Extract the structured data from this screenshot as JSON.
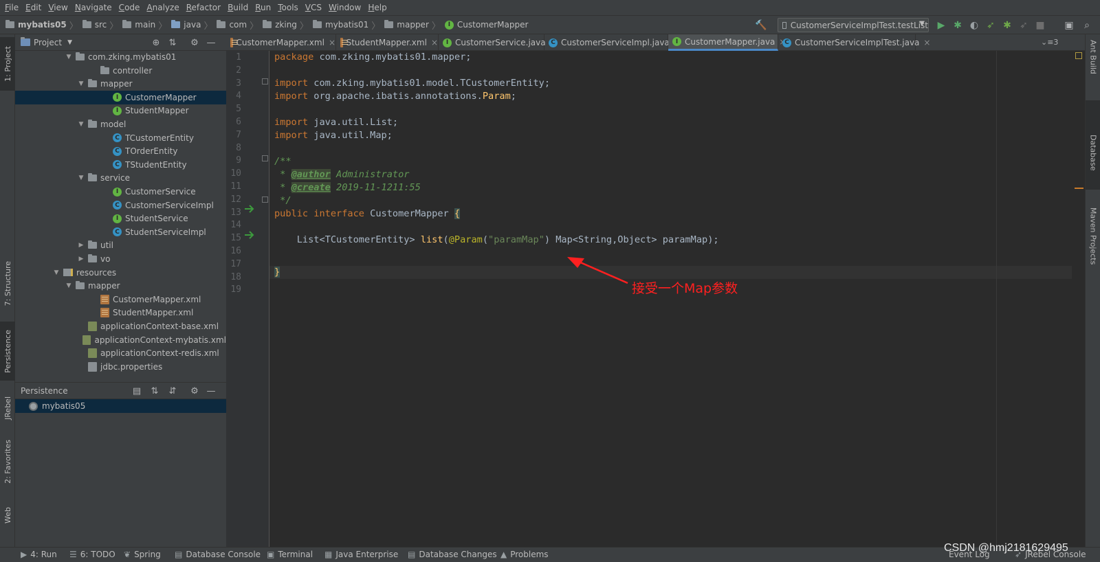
{
  "menu": [
    "File",
    "Edit",
    "View",
    "Navigate",
    "Code",
    "Analyze",
    "Refactor",
    "Build",
    "Run",
    "Tools",
    "VCS",
    "Window",
    "Help"
  ],
  "breadcrumbs": [
    "mybatis05",
    "src",
    "main",
    "java",
    "com",
    "zking",
    "mybatis01",
    "mapper",
    "CustomerMapper"
  ],
  "run_config": "CustomerServiceImplTest.testList",
  "project_panel": {
    "title": "Project"
  },
  "tree": [
    {
      "label": "com.zking.mybatis01",
      "type": "package",
      "arrow": "▼"
    },
    {
      "label": "controller",
      "type": "package",
      "arrow": ""
    },
    {
      "label": "mapper",
      "type": "package",
      "arrow": "▼"
    },
    {
      "label": "CustomerMapper",
      "type": "interface",
      "arrow": "",
      "selected": true
    },
    {
      "label": "StudentMapper",
      "type": "interface",
      "arrow": ""
    },
    {
      "label": "model",
      "type": "package",
      "arrow": "▼"
    },
    {
      "label": "TCustomerEntity",
      "type": "class",
      "arrow": ""
    },
    {
      "label": "TOrderEntity",
      "type": "class",
      "arrow": ""
    },
    {
      "label": "TStudentEntity",
      "type": "class",
      "arrow": ""
    },
    {
      "label": "service",
      "type": "package",
      "arrow": "▼"
    },
    {
      "label": "CustomerService",
      "type": "interface",
      "arrow": ""
    },
    {
      "label": "CustomerServiceImpl",
      "type": "class",
      "arrow": ""
    },
    {
      "label": "StudentService",
      "type": "interface",
      "arrow": ""
    },
    {
      "label": "StudentServiceImpl",
      "type": "class",
      "arrow": ""
    },
    {
      "label": "util",
      "type": "package",
      "arrow": "▶"
    },
    {
      "label": "vo",
      "type": "package",
      "arrow": "▶"
    },
    {
      "label": "resources",
      "type": "resources",
      "arrow": "▼"
    },
    {
      "label": "mapper",
      "type": "package",
      "arrow": "▼"
    },
    {
      "label": "CustomerMapper.xml",
      "type": "xml",
      "arrow": ""
    },
    {
      "label": "StudentMapper.xml",
      "type": "xml",
      "arrow": ""
    },
    {
      "label": "applicationContext-base.xml",
      "type": "spring",
      "arrow": ""
    },
    {
      "label": "applicationContext-mybatis.xml",
      "type": "spring",
      "arrow": ""
    },
    {
      "label": "applicationContext-redis.xml",
      "type": "spring",
      "arrow": ""
    },
    {
      "label": "jdbc.properties",
      "type": "props",
      "arrow": ""
    }
  ],
  "persistence": {
    "title": "Persistence",
    "item": "mybatis05"
  },
  "left_tabs": [
    "1: Project",
    "7: Structure",
    "Persistence",
    "JRebel",
    "2: Favorites",
    "Web"
  ],
  "right_tabs": [
    "Ant Build",
    "Database",
    "Maven Projects"
  ],
  "tabs": [
    {
      "label": "CustomerMapper.xml",
      "type": "xml"
    },
    {
      "label": "StudentMapper.xml",
      "type": "xml"
    },
    {
      "label": "CustomerService.java",
      "type": "interface"
    },
    {
      "label": "CustomerServiceImpl.java",
      "type": "class"
    },
    {
      "label": "CustomerMapper.java",
      "type": "interface",
      "active": true
    },
    {
      "label": "CustomerServiceImplTest.java",
      "type": "class"
    }
  ],
  "tabs_overflow": "⌄≡3",
  "code": {
    "line_numbers": [
      "1",
      "2",
      "3",
      "4",
      "5",
      "6",
      "7",
      "8",
      "9",
      "10",
      "11",
      "12",
      "13",
      "14",
      "15",
      "16",
      "17",
      "18",
      "19"
    ],
    "package_kw": "package",
    "package_name": " com.zking.mybatis01.mapper;",
    "import_kw": "import",
    "import1": " com.zking.mybatis01.model.TCustomerEntity;",
    "import2a": " org.apache.ibatis.annotations.",
    "import2b": "Param",
    "import3": " java.util.List;",
    "import4": " java.util.Map;",
    "doc_open": "/**",
    "author_prefix": " * ",
    "author_tag": "@author",
    "author_val": " Administrator",
    "create_tag": "@create",
    "create_val": " 2019-11-1211:55",
    "doc_close": " */",
    "public_kw": "public",
    "interface_kw": "interface",
    "iface_name": " CustomerMapper ",
    "open_brace": "{",
    "m_indent": "    List<TCustomerEntity> ",
    "m_name": "list",
    "m_paren": "(",
    "m_ann": "@Param",
    "m_str": "\"paramMap\"",
    "m_rest": ") Map<String,Object> paramMap);",
    "close_brace": "}"
  },
  "annotation": "接受一个Map参数",
  "status": [
    "4: Run",
    "6: TODO",
    "Spring",
    "Database Console",
    "Terminal",
    "Java Enterprise",
    "Database Changes",
    "Problems",
    "Event Log",
    "JRebel Console"
  ],
  "watermark": "CSDN @hmj2181629495"
}
